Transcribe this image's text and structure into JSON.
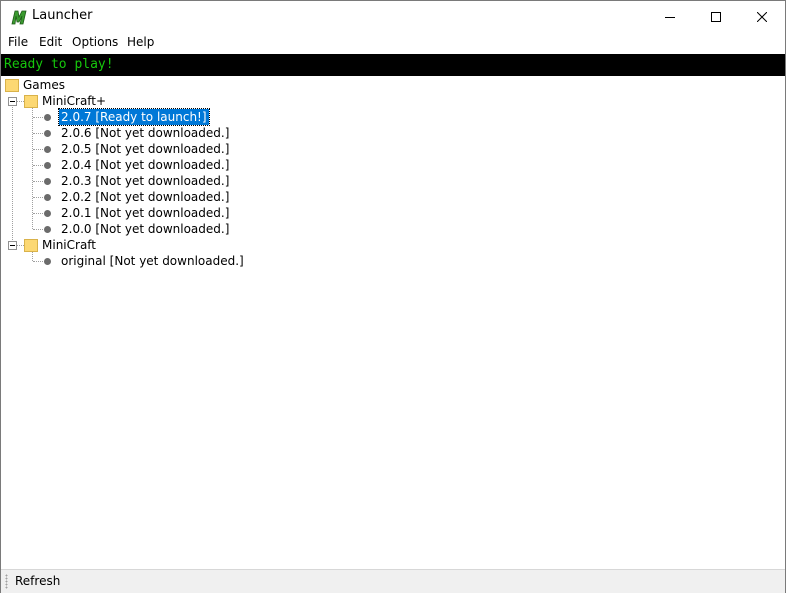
{
  "window": {
    "title": "Launcher",
    "icon": "minicraft-app-icon",
    "controls": [
      "minimize-icon",
      "maximize-icon",
      "close-icon"
    ]
  },
  "menu": {
    "file": "File",
    "edit": "Edit",
    "options": "Options",
    "help": "Help"
  },
  "status": {
    "text": "Ready to play!",
    "color": "#16c60c"
  },
  "tree": {
    "root": "Games",
    "groups": [
      {
        "name": "MiniCraft+",
        "items": [
          {
            "label": "2.0.7 [Ready to launch!]",
            "selected": true
          },
          {
            "label": "2.0.6 [Not yet downloaded.]"
          },
          {
            "label": "2.0.5 [Not yet downloaded.]"
          },
          {
            "label": "2.0.4 [Not yet downloaded.]"
          },
          {
            "label": "2.0.3 [Not yet downloaded.]"
          },
          {
            "label": "2.0.2 [Not yet downloaded.]"
          },
          {
            "label": "2.0.1 [Not yet downloaded.]"
          },
          {
            "label": "2.0.0 [Not yet downloaded.]"
          }
        ]
      },
      {
        "name": "MiniCraft",
        "items": [
          {
            "label": "original [Not yet downloaded.]"
          }
        ]
      }
    ]
  },
  "toolbar": {
    "refresh_label": "Refresh"
  },
  "colors": {
    "selection": "#0078d7",
    "folder": "#fcd873",
    "status_bg": "#000000"
  }
}
